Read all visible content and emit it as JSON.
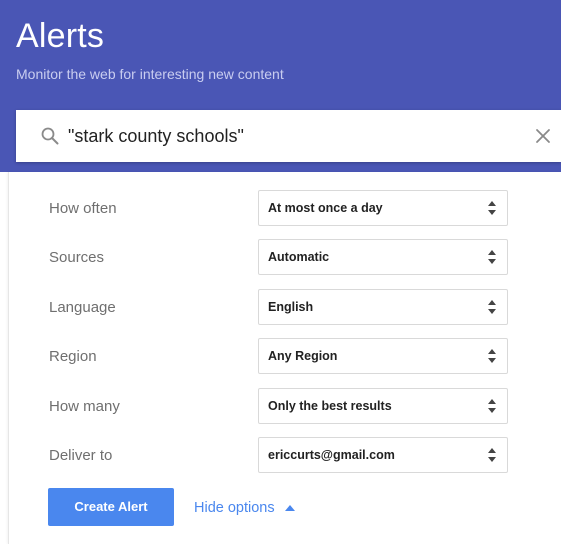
{
  "header": {
    "title": "Alerts",
    "subtitle": "Monitor the web for interesting new content"
  },
  "search": {
    "query": "\"stark county schools\"",
    "search_icon": "search-icon",
    "clear_icon": "close-icon"
  },
  "options": [
    {
      "label": "How often",
      "value": "At most once a day"
    },
    {
      "label": "Sources",
      "value": "Automatic"
    },
    {
      "label": "Language",
      "value": "English"
    },
    {
      "label": "Region",
      "value": "Any Region"
    },
    {
      "label": "How many",
      "value": "Only the best results"
    },
    {
      "label": "Deliver to",
      "value": "ericcurts@gmail.com"
    }
  ],
  "actions": {
    "create_label": "Create Alert",
    "hide_options_label": "Hide options"
  },
  "colors": {
    "header_bg": "#4a56b5",
    "accent": "#4a87ee"
  }
}
